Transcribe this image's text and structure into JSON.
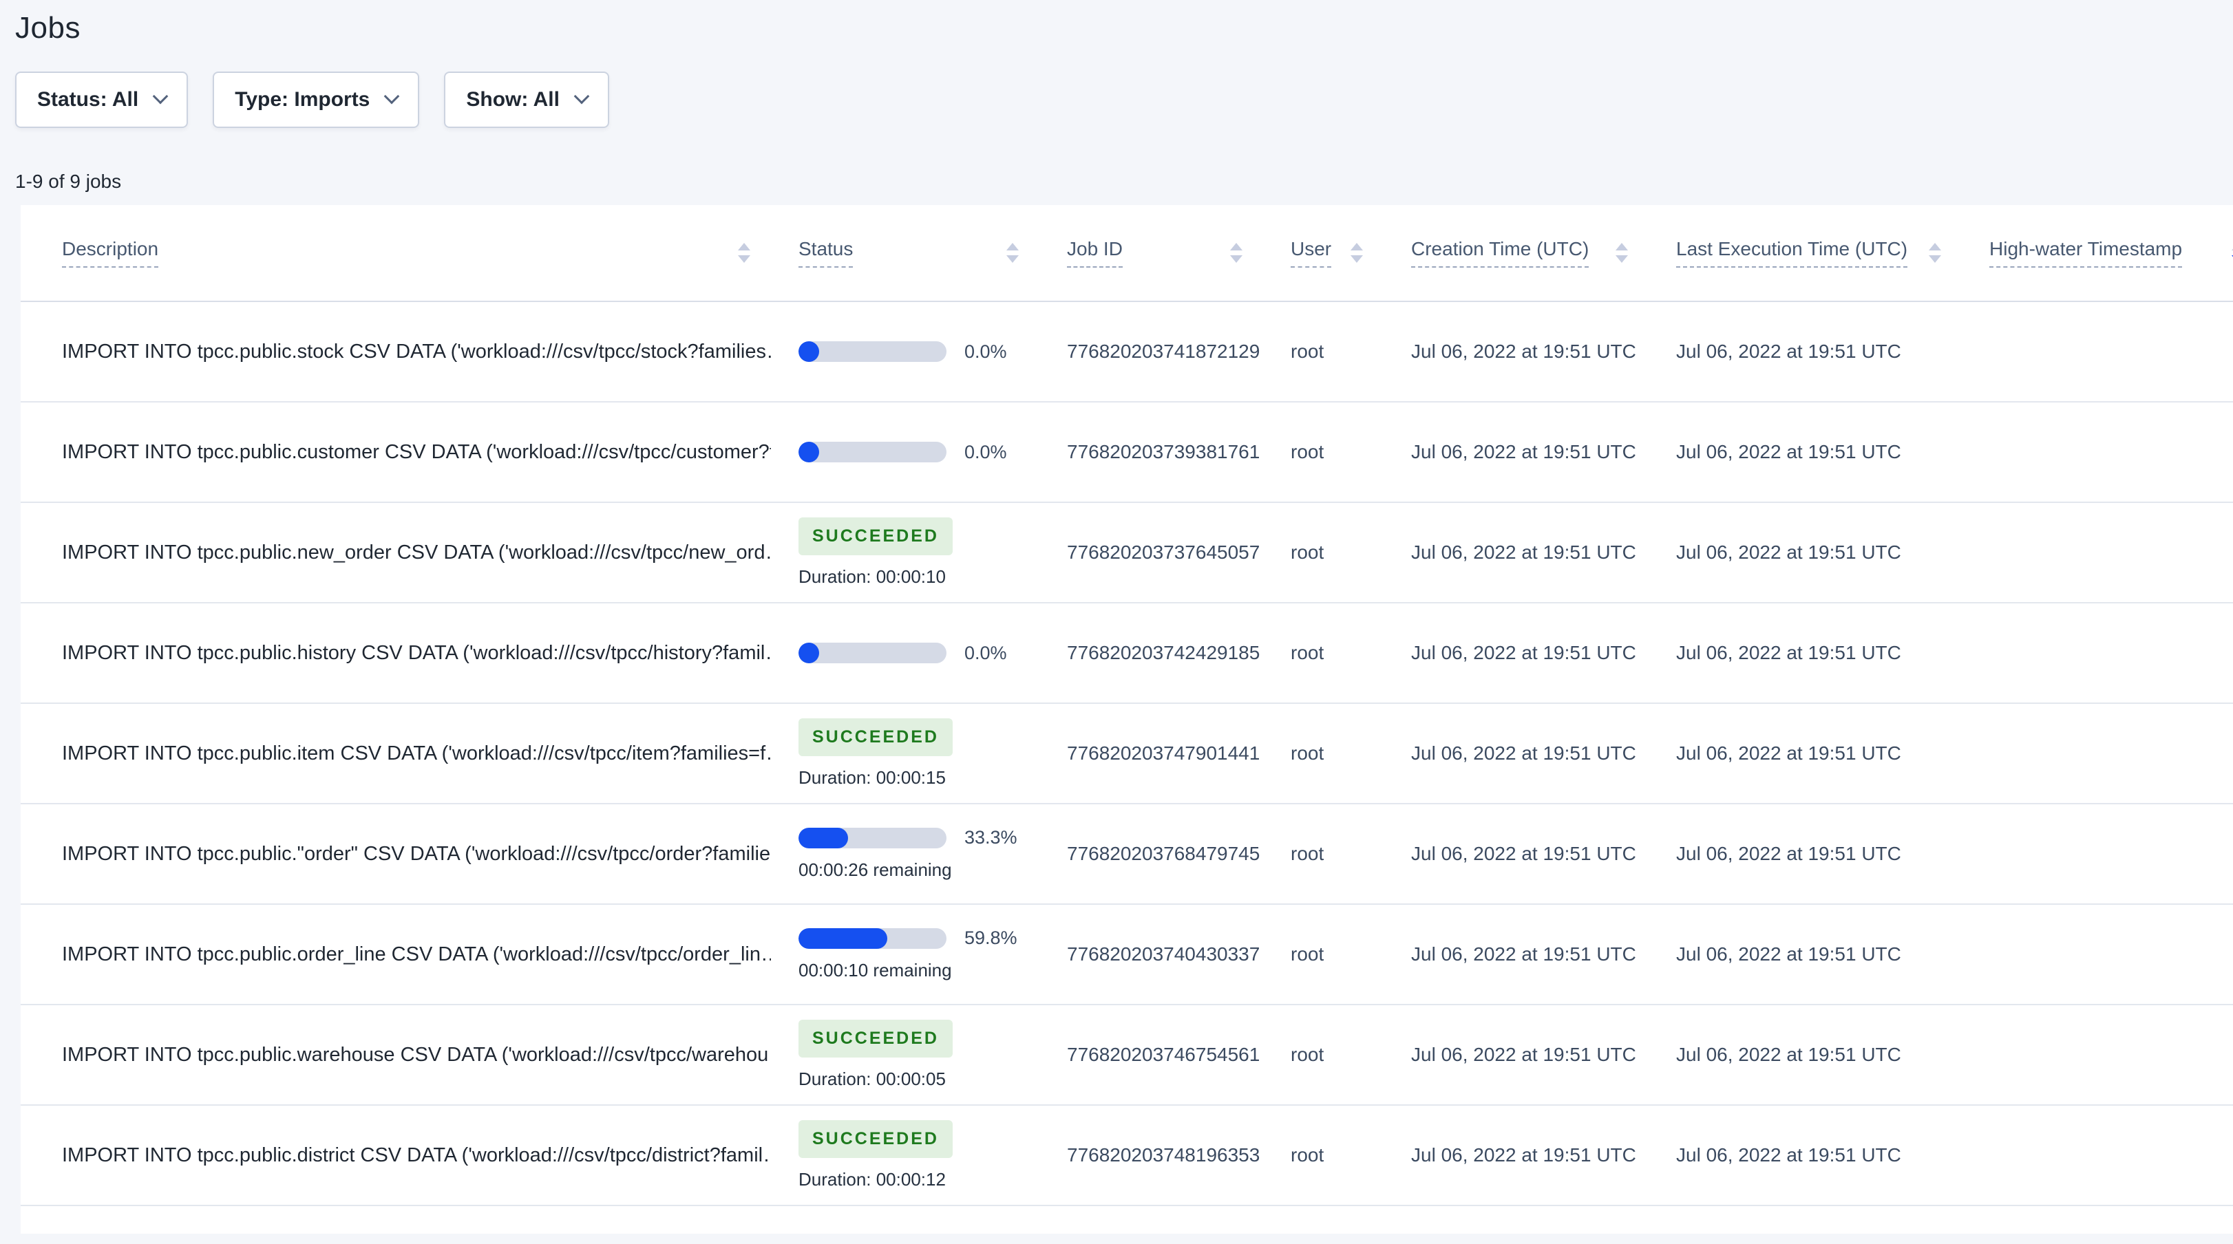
{
  "page": {
    "title": "Jobs"
  },
  "filters": [
    {
      "label": "Status: All"
    },
    {
      "label": "Type: Imports"
    },
    {
      "label": "Show: All"
    }
  ],
  "summary": "1-9 of 9 jobs",
  "colors": {
    "progress_fill": "#1550f0",
    "progress_track": "#d5dae6",
    "badge_bg": "#e1f0e0",
    "badge_text": "#1e7a1e",
    "sort_active": "#2553f6",
    "page_bg": "#f4f6fa"
  },
  "table": {
    "columns": [
      {
        "label": "Description",
        "sort": "none"
      },
      {
        "label": "Status",
        "sort": "none"
      },
      {
        "label": "Job ID",
        "sort": "none"
      },
      {
        "label": "User",
        "sort": "none"
      },
      {
        "label": "Creation Time (UTC)",
        "sort": "none"
      },
      {
        "label": "Last Execution Time (UTC)",
        "sort": "none"
      },
      {
        "label": "High-water Timestamp",
        "sort": "desc"
      }
    ],
    "rows": [
      {
        "description": "IMPORT INTO tpcc.public.stock CSV DATA ('workload:///csv/tpcc/stock?families…",
        "status": {
          "state": "running",
          "percent": 0.0,
          "percent_label": "0.0%",
          "remaining_label": ""
        },
        "job_id": "776820203741872129",
        "user": "root",
        "creation_time": "Jul 06, 2022 at 19:51 UTC",
        "last_execution_time": "Jul 06, 2022 at 19:51 UTC",
        "high_water_timestamp": ""
      },
      {
        "description": "IMPORT INTO tpcc.public.customer CSV DATA ('workload:///csv/tpcc/customer?f…",
        "status": {
          "state": "running",
          "percent": 0.0,
          "percent_label": "0.0%",
          "remaining_label": ""
        },
        "job_id": "776820203739381761",
        "user": "root",
        "creation_time": "Jul 06, 2022 at 19:51 UTC",
        "last_execution_time": "Jul 06, 2022 at 19:51 UTC",
        "high_water_timestamp": ""
      },
      {
        "description": "IMPORT INTO tpcc.public.new_order CSV DATA ('workload:///csv/tpcc/new_ord…",
        "status": {
          "state": "succeeded",
          "badge_label": "SUCCEEDED",
          "duration_label": "Duration: 00:00:10"
        },
        "job_id": "776820203737645057",
        "user": "root",
        "creation_time": "Jul 06, 2022 at 19:51 UTC",
        "last_execution_time": "Jul 06, 2022 at 19:51 UTC",
        "high_water_timestamp": ""
      },
      {
        "description": "IMPORT INTO tpcc.public.history CSV DATA ('workload:///csv/tpcc/history?famil…",
        "status": {
          "state": "running",
          "percent": 0.0,
          "percent_label": "0.0%",
          "remaining_label": ""
        },
        "job_id": "776820203742429185",
        "user": "root",
        "creation_time": "Jul 06, 2022 at 19:51 UTC",
        "last_execution_time": "Jul 06, 2022 at 19:51 UTC",
        "high_water_timestamp": ""
      },
      {
        "description": "IMPORT INTO tpcc.public.item CSV DATA ('workload:///csv/tpcc/item?families=f…",
        "status": {
          "state": "succeeded",
          "badge_label": "SUCCEEDED",
          "duration_label": "Duration: 00:00:15"
        },
        "job_id": "776820203747901441",
        "user": "root",
        "creation_time": "Jul 06, 2022 at 19:51 UTC",
        "last_execution_time": "Jul 06, 2022 at 19:51 UTC",
        "high_water_timestamp": ""
      },
      {
        "description": "IMPORT INTO tpcc.public.\"order\" CSV DATA ('workload:///csv/tpcc/order?familie…",
        "status": {
          "state": "running",
          "percent": 33.3,
          "percent_label": "33.3%",
          "remaining_label": "00:00:26 remaining"
        },
        "job_id": "776820203768479745",
        "user": "root",
        "creation_time": "Jul 06, 2022 at 19:51 UTC",
        "last_execution_time": "Jul 06, 2022 at 19:51 UTC",
        "high_water_timestamp": ""
      },
      {
        "description": "IMPORT INTO tpcc.public.order_line CSV DATA ('workload:///csv/tpcc/order_lin…",
        "status": {
          "state": "running",
          "percent": 59.8,
          "percent_label": "59.8%",
          "remaining_label": "00:00:10 remaining"
        },
        "job_id": "776820203740430337",
        "user": "root",
        "creation_time": "Jul 06, 2022 at 19:51 UTC",
        "last_execution_time": "Jul 06, 2022 at 19:51 UTC",
        "high_water_timestamp": ""
      },
      {
        "description": "IMPORT INTO tpcc.public.warehouse CSV DATA ('workload:///csv/tpcc/warehou…",
        "status": {
          "state": "succeeded",
          "badge_label": "SUCCEEDED",
          "duration_label": "Duration: 00:00:05"
        },
        "job_id": "776820203746754561",
        "user": "root",
        "creation_time": "Jul 06, 2022 at 19:51 UTC",
        "last_execution_time": "Jul 06, 2022 at 19:51 UTC",
        "high_water_timestamp": ""
      },
      {
        "description": "IMPORT INTO tpcc.public.district CSV DATA ('workload:///csv/tpcc/district?famil…",
        "status": {
          "state": "succeeded",
          "badge_label": "SUCCEEDED",
          "duration_label": "Duration: 00:00:12"
        },
        "job_id": "776820203748196353",
        "user": "root",
        "creation_time": "Jul 06, 2022 at 19:51 UTC",
        "last_execution_time": "Jul 06, 2022 at 19:51 UTC",
        "high_water_timestamp": ""
      }
    ]
  }
}
